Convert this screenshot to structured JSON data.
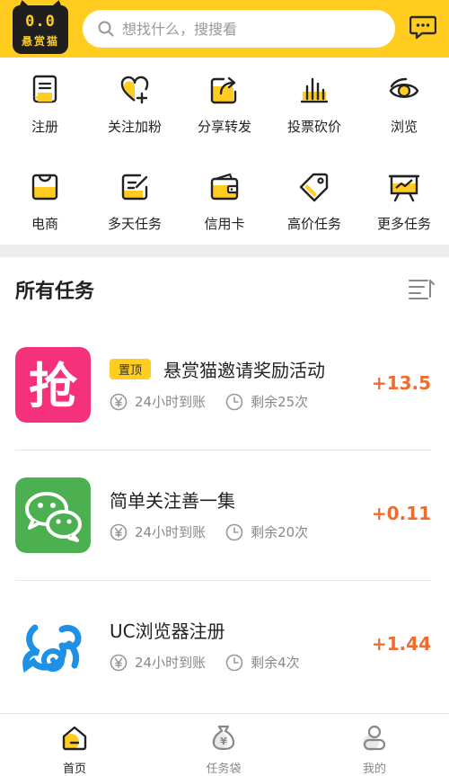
{
  "header": {
    "logo_eyes": "0.0",
    "logo_name": "悬赏猫",
    "search_placeholder": "想找什么，搜搜看"
  },
  "categories": [
    {
      "label": "注册",
      "icon": "register-icon"
    },
    {
      "label": "关注加粉",
      "icon": "heart-plus-icon"
    },
    {
      "label": "分享转发",
      "icon": "share-icon"
    },
    {
      "label": "投票砍价",
      "icon": "vote-chart-icon"
    },
    {
      "label": "浏览",
      "icon": "eye-icon"
    },
    {
      "label": "电商",
      "icon": "shopping-bag-icon"
    },
    {
      "label": "多天任务",
      "icon": "edit-note-icon"
    },
    {
      "label": "信用卡",
      "icon": "wallet-icon"
    },
    {
      "label": "高价任务",
      "icon": "price-tag-icon"
    },
    {
      "label": "更多任务",
      "icon": "presentation-icon"
    }
  ],
  "section": {
    "title": "所有任务"
  },
  "tasks": [
    {
      "badge": "置顶",
      "title": "悬赏猫邀请奖励活动",
      "settle": "24小时到账",
      "remaining": "剩余25次",
      "reward": "+13.5",
      "thumb_text": "抢"
    },
    {
      "badge": "",
      "title": "简单关注善一集",
      "settle": "24小时到账",
      "remaining": "剩余20次",
      "reward": "+0.11"
    },
    {
      "badge": "",
      "title": "UC浏览器注册",
      "settle": "24小时到账",
      "remaining": "剩余4次",
      "reward": "+1.44"
    }
  ],
  "nav": {
    "home": "首页",
    "tasks": "任务袋",
    "mine": "我的",
    "tasks_icon_text": "¥"
  },
  "colors": {
    "brand": "#FFCC1F",
    "reward": "#F26B2B"
  }
}
